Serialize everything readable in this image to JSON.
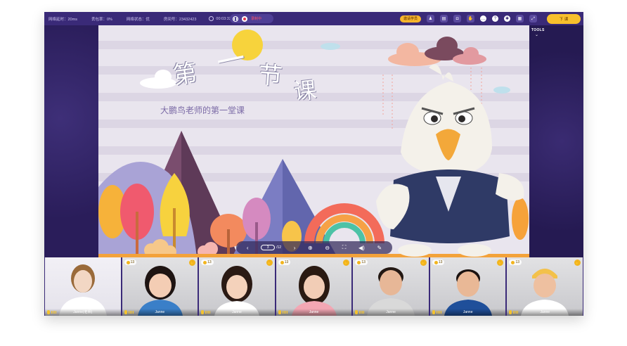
{
  "topbar": {
    "stats": [
      {
        "label": "网络延时：20ms"
      },
      {
        "label": "丢包率：0%"
      },
      {
        "label": "网络状态：优"
      },
      {
        "label": "房间号：23432423"
      }
    ],
    "timer": "00:03:32",
    "recording_label": "录制中",
    "invite_label": "邀请学员",
    "end_label": "下 课"
  },
  "tools_label": "TOOLS",
  "slide": {
    "title_chars": [
      "第",
      "一",
      "节",
      "课"
    ],
    "subtitle": "大鹏鸟老师的第一堂课"
  },
  "pager": {
    "current": "3",
    "total": "/12"
  },
  "participants": [
    {
      "name": "Janne(老师)",
      "coins": "",
      "is_teacher": true,
      "skin": "#f2d7c4",
      "hair": "#9a6a3a",
      "shirt": "#ffffff"
    },
    {
      "name": "Janne",
      "coins": "13",
      "skin": "#f4cdb4",
      "hair": "#1e1412",
      "shirt": "#3a7fc8"
    },
    {
      "name": "Janne",
      "coins": "13",
      "skin": "#f4d2bb",
      "hair": "#2a1a14",
      "shirt": "#ffffff"
    },
    {
      "name": "Janne",
      "coins": "13",
      "skin": "#f2cdb6",
      "hair": "#2a1a12",
      "shirt": "#f3a7b4"
    },
    {
      "name": "Janne",
      "coins": "13",
      "skin": "#e7b797",
      "hair": "#231813",
      "shirt": "#d9d9d9"
    },
    {
      "name": "Janne",
      "coins": "13",
      "skin": "#e9b896",
      "hair": "#1a1210",
      "shirt": "#1f4f9a"
    },
    {
      "name": "Janne",
      "coins": "13",
      "skin": "#eec0a0",
      "hair": "#f3c14a",
      "shirt": "#ffffff"
    }
  ],
  "colors": {
    "frame": "#2d1f5c",
    "topbar": "#3a2a78",
    "accent": "#f8c02c",
    "record": "#e53b50"
  }
}
